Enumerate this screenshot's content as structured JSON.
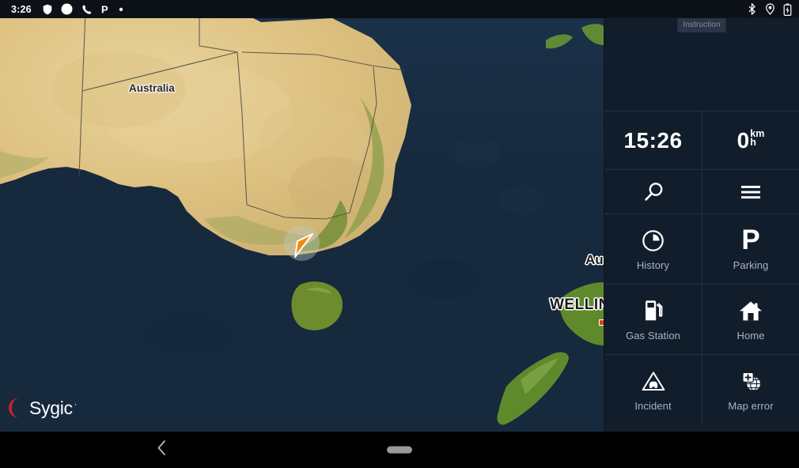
{
  "status_bar": {
    "clock": "3:26",
    "left_icons": [
      "shield-icon",
      "circle-icon",
      "phone-icon",
      "parking-icon",
      "dot-icon"
    ],
    "right_icons": [
      "bluetooth-icon",
      "location-pin-icon",
      "battery-charging-icon"
    ]
  },
  "map": {
    "country_label": "Australia",
    "city_label_partial": "Au",
    "capital_label_partial": "WELLIN",
    "position_marker": "vehicle-arrow",
    "brand": {
      "name": "Sygic",
      "logo_color": "#cc2229",
      "trademark": "·"
    },
    "colors": {
      "ocean": "#16293d",
      "land": "#e0c288",
      "land_green": "#6d8c2e",
      "border": "#4a4a46"
    }
  },
  "panel": {
    "instruction_placeholder": "Instruction",
    "clock": "15:26",
    "speed": {
      "value": "0",
      "unit_numerator": "km",
      "unit_denominator": "h"
    },
    "tools": [
      {
        "name": "search",
        "icon": "search-icon"
      },
      {
        "name": "menu",
        "icon": "hamburger-menu-icon"
      }
    ],
    "tiles": [
      {
        "label": "History",
        "icon": "clock-history-icon"
      },
      {
        "label": "Parking",
        "icon": "parking-p-icon"
      },
      {
        "label": "Gas Station",
        "icon": "fuel-pump-icon"
      },
      {
        "label": "Home",
        "icon": "house-icon"
      },
      {
        "label": "Incident",
        "icon": "warning-triangle-car-icon"
      },
      {
        "label": "Map error",
        "icon": "globe-plus-icon"
      }
    ],
    "accent": "#a8b4c2",
    "background": "#121d2b"
  },
  "nav_bar": {
    "back": "back-chevron-icon",
    "home": "home-pill-indicator"
  }
}
